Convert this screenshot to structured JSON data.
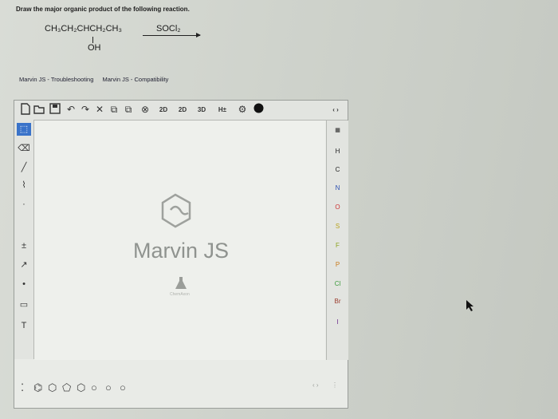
{
  "question": "Draw the major organic product of the following reaction.",
  "reaction": {
    "reactant": "CH₃CH₂CHCH₂CH₃",
    "substituent": "OH",
    "reagent": "SOCl₂"
  },
  "links": [
    "Marvin JS - Troubleshooting",
    "Marvin JS - Compatibility"
  ],
  "toolbar": {
    "tools": [
      "new-document",
      "open",
      "save",
      "undo",
      "redo",
      "clear",
      "copy",
      "paste",
      "zoom"
    ],
    "stereo_labels": [
      "2D",
      "2D",
      "3D"
    ],
    "hydrogen_label": "H±",
    "expand": "‹ ›"
  },
  "elements": [
    "H",
    "C",
    "N",
    "O",
    "S",
    "F",
    "P",
    "Cl",
    "Br",
    "I"
  ],
  "canvas": {
    "logo_text": "Marvin JS",
    "brand": "ChemAxon"
  },
  "bottom_tools": [
    "benzene",
    "cyclohexane",
    "cyclopentane",
    "cyclohexene",
    "cyclobutane",
    "cyclopropane",
    "ring-other"
  ]
}
